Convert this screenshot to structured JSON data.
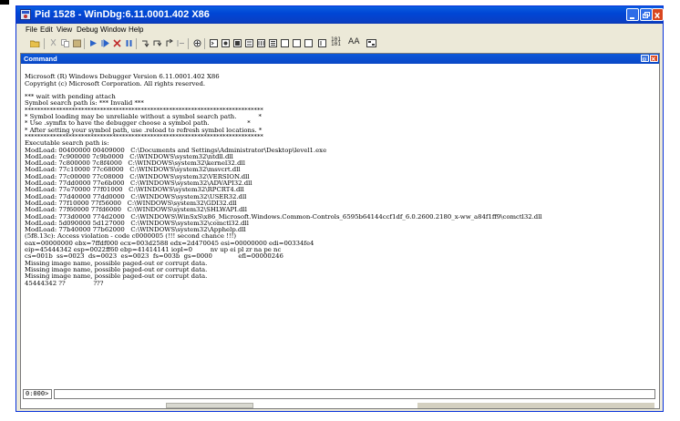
{
  "window": {
    "title": "Pid 1528 - WinDbg:6.11.0001.402 X86",
    "icons": {
      "app": "windbg-icon",
      "minimize": "minimize-icon",
      "maximize": "maximize-icon",
      "close": "close-icon"
    }
  },
  "menu": [
    "File",
    "Edit",
    "View",
    "Debug",
    "Window",
    "Help"
  ],
  "toolbar": {
    "icons": [
      "open-icon",
      "cut-icon",
      "copy-icon",
      "paste-icon",
      "go-icon",
      "restart-icon",
      "stop-icon",
      "break-icon",
      "step-into-icon",
      "step-over-icon",
      "step-out-icon",
      "run-to-cursor-icon",
      "breakpoint-icon",
      "command-window-icon",
      "watch-icon",
      "locals-icon",
      "registers-icon",
      "memory-icon",
      "call-stack-icon",
      "disassembly-icon",
      "scratch-pad-icon",
      "source-mode-icon",
      "hex-icon",
      "font-icon",
      "options-icon"
    ],
    "hex_label": "101\n101",
    "font_label": "AA"
  },
  "command_window": {
    "title": "Command",
    "output_lines": [
      "",
      "Microsoft (R) Windows Debugger Version 6.11.0001.402 X86",
      "Copyright (c) Microsoft Corporation. All rights reserved.",
      "",
      "*** wait with pending attach",
      "Symbol search path is: *** Invalid ***",
      "****************************************************************************",
      "* Symbol loading may be unreliable without a symbol search path.           *",
      "* Use .symfix to have the debugger choose a symbol path.                   *",
      "* After setting your symbol path, use .reload to refresh symbol locations. *",
      "****************************************************************************",
      "Executable search path is:",
      "ModLoad: 00400000 00409000   C:\\Documents and Settings\\Administrator\\Desktop\\level1.exe",
      "ModLoad: 7c900000 7c9b0000   C:\\WINDOWS\\system32\\ntdll.dll",
      "ModLoad: 7c800000 7c8f4000   C:\\WINDOWS\\system32\\kernel32.dll",
      "ModLoad: 77c10000 77c68000   C:\\WINDOWS\\system32\\msvcrt.dll",
      "ModLoad: 77c00000 77c08000   C:\\WINDOWS\\system32\\VERSION.dll",
      "ModLoad: 77dd0000 77e6b000   C:\\WINDOWS\\system32\\ADVAPI32.dll",
      "ModLoad: 77e70000 77f01000   C:\\WINDOWS\\system32\\RPCRT4.dll",
      "ModLoad: 77d40000 77dd0000   C:\\WINDOWS\\system32\\USER32.dll",
      "ModLoad: 77f10000 77f56000   C:\\WINDOWS\\system32\\GDI32.dll",
      "ModLoad: 77f60000 77fd6000   C:\\WINDOWS\\system32\\SHLWAPI.dll",
      "ModLoad: 773d0000 774d2000   C:\\WINDOWS\\WinSxS\\x86_Microsoft.Windows.Common-Controls_6595b64144ccf1df_6.0.2600.2180_x-ww_a84f1ff9\\comctl32.dll",
      "ModLoad: 5d090000 5d127000   C:\\WINDOWS\\system32\\comctl32.dll",
      "ModLoad: 77b40000 77b62000   C:\\WINDOWS\\system32\\Apphelp.dll",
      "(5f8.13c): Access violation - code c0000005 (!!! second chance !!!)",
      "eax=00000000 ebx=7ffdf000 ecx=003d2588 edx=2d470045 esi=00000000 edi=00334fe4",
      "eip=45444342 esp=0022ff60 ebp=41414141 iopl=0         nv up ei pl zr na pe nc",
      "cs=001b  ss=0023  ds=0023  es=0023  fs=003b  gs=0000             efl=00000246",
      "Missing image name, possible paged-out or corrupt data.",
      "Missing image name, possible paged-out or corrupt data.",
      "Missing image name, possible paged-out or corrupt data.",
      "45444342 ??              ???"
    ],
    "prompt": "0:000>",
    "command_value": ""
  }
}
